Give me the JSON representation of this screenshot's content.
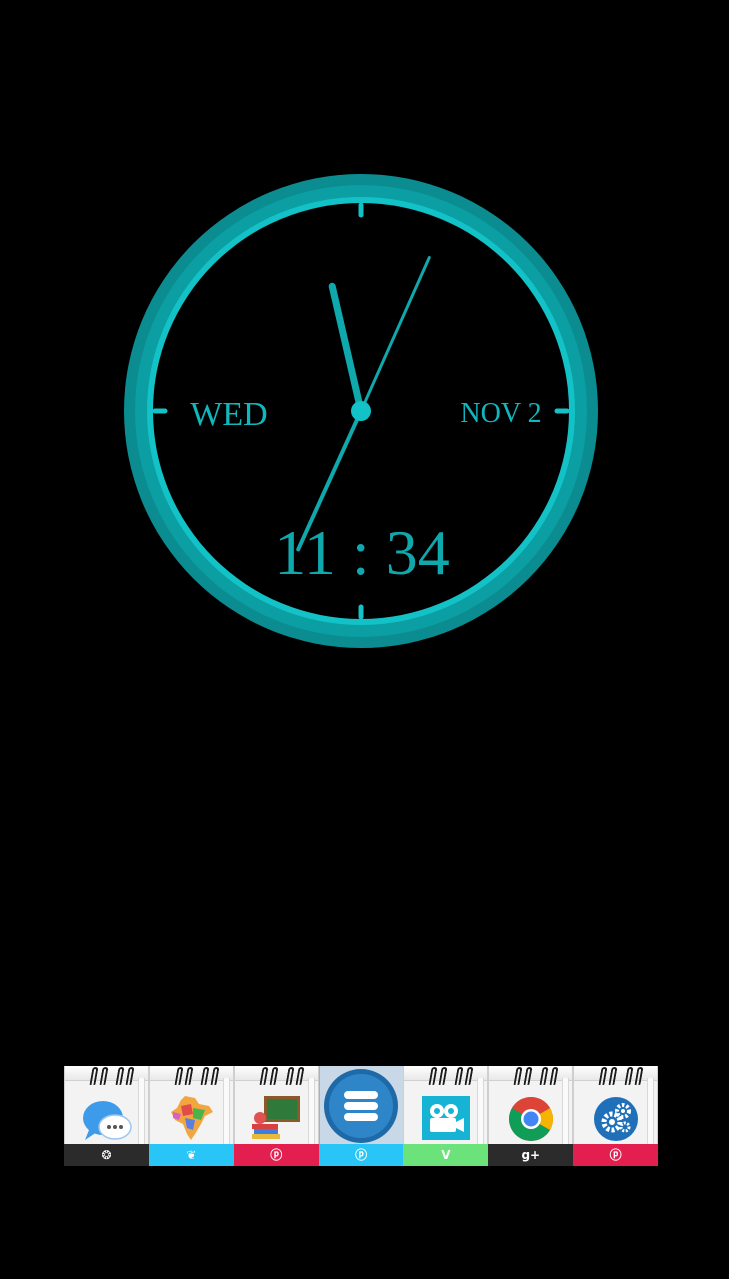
{
  "clock": {
    "day_label": "WED",
    "date_label": "NOV 2",
    "time_label": "11 : 34",
    "accent_color": "#0fb8bd",
    "ring_outer_color": "#0a8f93",
    "hour": 11,
    "minute": 34,
    "second": 4
  },
  "dock": {
    "items": [
      {
        "app": "chat-app",
        "icon": "chat-bubbles-icon",
        "badge_icon": "github-icon",
        "badge_glyph": "❂",
        "badge_color": "#2b2b2b"
      },
      {
        "app": "india-map-app",
        "icon": "india-map-icon",
        "badge_icon": "twitter-icon",
        "badge_glyph": "❦",
        "badge_color": "#29c5f6"
      },
      {
        "app": "education-app",
        "icon": "chalkboard-books-icon",
        "badge_icon": "pinterest-icon",
        "badge_glyph": "ⓟ",
        "badge_color": "#e21f4f"
      },
      {
        "app": "app-drawer",
        "icon": "menu-icon",
        "badge_icon": "pinterest-icon",
        "badge_glyph": "ⓟ",
        "badge_color": "#29c5f6"
      },
      {
        "app": "video-camera-app",
        "icon": "video-camera-icon",
        "badge_icon": "vine-icon",
        "badge_glyph": "V",
        "badge_color": "#6be27a"
      },
      {
        "app": "chrome-browser",
        "icon": "chrome-icon",
        "badge_icon": "google-plus-icon",
        "badge_glyph": "g+",
        "badge_color": "#2b2b2b"
      },
      {
        "app": "settings-app",
        "icon": "gears-icon",
        "badge_icon": "pinterest-icon",
        "badge_glyph": "ⓟ",
        "badge_color": "#e21f4f"
      }
    ]
  }
}
